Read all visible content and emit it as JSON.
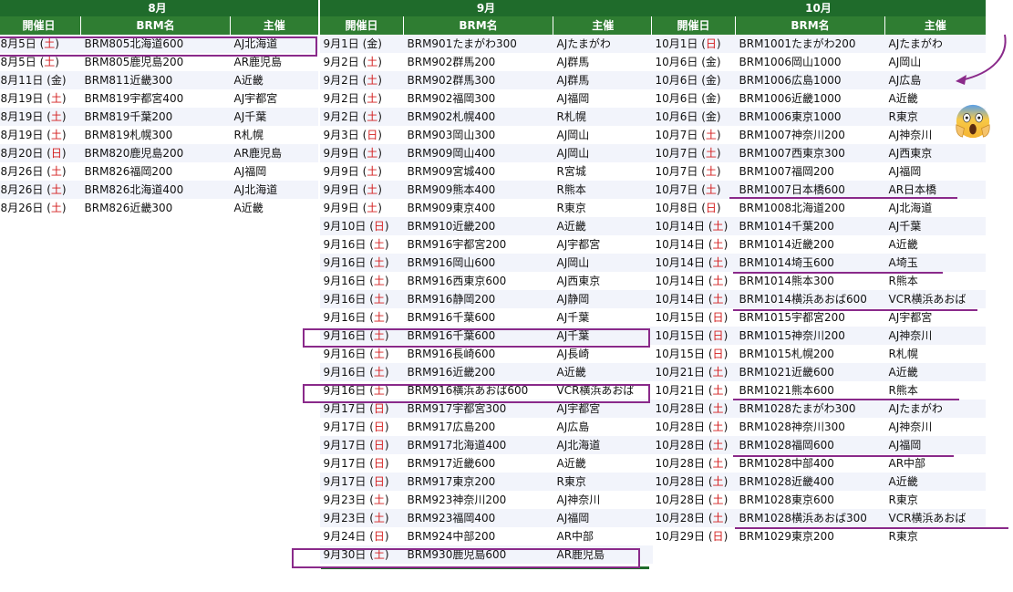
{
  "columns": [
    {
      "month": "8月",
      "headers": [
        "開催日",
        "BRM名",
        "主催"
      ],
      "rows": [
        {
          "date": "8月5日",
          "wd": "土",
          "name": "BRM805北海道600",
          "org": "AJ北海道"
        },
        {
          "date": "8月5日",
          "wd": "土",
          "name": "BRM805鹿児島200",
          "org": "AR鹿児島"
        },
        {
          "date": "8月11日",
          "wd": "金",
          "name": "BRM811近畿300",
          "org": "A近畿"
        },
        {
          "date": "8月19日",
          "wd": "土",
          "name": "BRM819宇都宮400",
          "org": "AJ宇都宮"
        },
        {
          "date": "8月19日",
          "wd": "土",
          "name": "BRM819千葉200",
          "org": "AJ千葉"
        },
        {
          "date": "8月19日",
          "wd": "土",
          "name": "BRM819札幌300",
          "org": "R札幌"
        },
        {
          "date": "8月20日",
          "wd": "日",
          "name": "BRM820鹿児島200",
          "org": "AR鹿児島"
        },
        {
          "date": "8月26日",
          "wd": "土",
          "name": "BRM826福岡200",
          "org": "AJ福岡"
        },
        {
          "date": "8月26日",
          "wd": "土",
          "name": "BRM826北海道400",
          "org": "AJ北海道"
        },
        {
          "date": "8月26日",
          "wd": "土",
          "name": "BRM826近畿300",
          "org": "A近畿"
        }
      ]
    },
    {
      "month": "9月",
      "headers": [
        "開催日",
        "BRM名",
        "主催"
      ],
      "rows": [
        {
          "date": "9月1日",
          "wd": "金",
          "name": "BRM901たまがわ300",
          "org": "AJたまがわ"
        },
        {
          "date": "9月2日",
          "wd": "土",
          "name": "BRM902群馬200",
          "org": "AJ群馬"
        },
        {
          "date": "9月2日",
          "wd": "土",
          "name": "BRM902群馬300",
          "org": "AJ群馬"
        },
        {
          "date": "9月2日",
          "wd": "土",
          "name": "BRM902福岡300",
          "org": "AJ福岡"
        },
        {
          "date": "9月2日",
          "wd": "土",
          "name": "BRM902札幌400",
          "org": "R札幌"
        },
        {
          "date": "9月3日",
          "wd": "日",
          "name": "BRM903岡山300",
          "org": "AJ岡山"
        },
        {
          "date": "9月9日",
          "wd": "土",
          "name": "BRM909岡山400",
          "org": "AJ岡山"
        },
        {
          "date": "9月9日",
          "wd": "土",
          "name": "BRM909宮城400",
          "org": "R宮城"
        },
        {
          "date": "9月9日",
          "wd": "土",
          "name": "BRM909熊本400",
          "org": "R熊本"
        },
        {
          "date": "9月9日",
          "wd": "土",
          "name": "BRM909東京400",
          "org": "R東京"
        },
        {
          "date": "9月10日",
          "wd": "日",
          "name": "BRM910近畿200",
          "org": "A近畿"
        },
        {
          "date": "9月16日",
          "wd": "土",
          "name": "BRM916宇都宮200",
          "org": "AJ宇都宮"
        },
        {
          "date": "9月16日",
          "wd": "土",
          "name": "BRM916岡山600",
          "org": "AJ岡山"
        },
        {
          "date": "9月16日",
          "wd": "土",
          "name": "BRM916西東京600",
          "org": "AJ西東京"
        },
        {
          "date": "9月16日",
          "wd": "土",
          "name": "BRM916静岡200",
          "org": "AJ静岡"
        },
        {
          "date": "9月16日",
          "wd": "土",
          "name": "BRM916千葉600",
          "org": "AJ千葉"
        },
        {
          "date": "9月16日",
          "wd": "土",
          "name": "BRM916千葉600",
          "org": "AJ千葉"
        },
        {
          "date": "9月16日",
          "wd": "土",
          "name": "BRM916長崎600",
          "org": "AJ長崎"
        },
        {
          "date": "9月16日",
          "wd": "土",
          "name": "BRM916近畿200",
          "org": "A近畿"
        },
        {
          "date": "9月16日",
          "wd": "土",
          "name": "BRM916横浜あおば600",
          "org": "VCR横浜あおば"
        },
        {
          "date": "9月17日",
          "wd": "日",
          "name": "BRM917宇都宮300",
          "org": "AJ宇都宮"
        },
        {
          "date": "9月17日",
          "wd": "日",
          "name": "BRM917広島200",
          "org": "AJ広島"
        },
        {
          "date": "9月17日",
          "wd": "日",
          "name": "BRM917北海道400",
          "org": "AJ北海道"
        },
        {
          "date": "9月17日",
          "wd": "日",
          "name": "BRM917近畿600",
          "org": "A近畿"
        },
        {
          "date": "9月17日",
          "wd": "日",
          "name": "BRM917東京200",
          "org": "R東京"
        },
        {
          "date": "9月23日",
          "wd": "土",
          "name": "BRM923神奈川200",
          "org": "AJ神奈川"
        },
        {
          "date": "9月23日",
          "wd": "土",
          "name": "BRM923福岡400",
          "org": "AJ福岡"
        },
        {
          "date": "9月24日",
          "wd": "日",
          "name": "BRM924中部200",
          "org": "AR中部"
        },
        {
          "date": "9月30日",
          "wd": "土",
          "name": "BRM930鹿児島600",
          "org": "AR鹿児島"
        }
      ]
    },
    {
      "month": "10月",
      "headers": [
        "開催日",
        "BRM名",
        "主催"
      ],
      "rows": [
        {
          "date": "10月1日",
          "wd": "日",
          "name": "BRM1001たまがわ200",
          "org": "AJたまがわ"
        },
        {
          "date": "10月6日",
          "wd": "金",
          "name": "BRM1006岡山1000",
          "org": "AJ岡山"
        },
        {
          "date": "10月6日",
          "wd": "金",
          "name": "BRM1006広島1000",
          "org": "AJ広島"
        },
        {
          "date": "10月6日",
          "wd": "金",
          "name": "BRM1006近畿1000",
          "org": "A近畿"
        },
        {
          "date": "10月6日",
          "wd": "金",
          "name": "BRM1006東京1000",
          "org": "R東京"
        },
        {
          "date": "10月7日",
          "wd": "土",
          "name": "BRM1007神奈川200",
          "org": "AJ神奈川"
        },
        {
          "date": "10月7日",
          "wd": "土",
          "name": "BRM1007西東京300",
          "org": "AJ西東京"
        },
        {
          "date": "10月7日",
          "wd": "土",
          "name": "BRM1007福岡200",
          "org": "AJ福岡"
        },
        {
          "date": "10月7日",
          "wd": "土",
          "name": "BRM1007日本橋600",
          "org": "AR日本橋"
        },
        {
          "date": "10月8日",
          "wd": "日",
          "name": "BRM1008北海道200",
          "org": "AJ北海道"
        },
        {
          "date": "10月14日",
          "wd": "土",
          "name": "BRM1014千葉200",
          "org": "AJ千葉"
        },
        {
          "date": "10月14日",
          "wd": "土",
          "name": "BRM1014近畿200",
          "org": "A近畿"
        },
        {
          "date": "10月14日",
          "wd": "土",
          "name": "BRM1014埼玉600",
          "org": "A埼玉"
        },
        {
          "date": "10月14日",
          "wd": "土",
          "name": "BRM1014熊本300",
          "org": "R熊本"
        },
        {
          "date": "10月14日",
          "wd": "土",
          "name": "BRM1014横浜あおば600",
          "org": "VCR横浜あおば"
        },
        {
          "date": "10月15日",
          "wd": "日",
          "name": "BRM1015宇都宮200",
          "org": "AJ宇都宮"
        },
        {
          "date": "10月15日",
          "wd": "日",
          "name": "BRM1015神奈川200",
          "org": "AJ神奈川"
        },
        {
          "date": "10月15日",
          "wd": "日",
          "name": "BRM1015札幌200",
          "org": "R札幌"
        },
        {
          "date": "10月21日",
          "wd": "土",
          "name": "BRM1021近畿600",
          "org": "A近畿"
        },
        {
          "date": "10月21日",
          "wd": "土",
          "name": "BRM1021熊本600",
          "org": "R熊本"
        },
        {
          "date": "10月28日",
          "wd": "土",
          "name": "BRM1028たまがわ300",
          "org": "AJたまがわ"
        },
        {
          "date": "10月28日",
          "wd": "土",
          "name": "BRM1028神奈川300",
          "org": "AJ神奈川"
        },
        {
          "date": "10月28日",
          "wd": "土",
          "name": "BRM1028福岡600",
          "org": "AJ福岡"
        },
        {
          "date": "10月28日",
          "wd": "土",
          "name": "BRM1028中部400",
          "org": "AR中部"
        },
        {
          "date": "10月28日",
          "wd": "土",
          "name": "BRM1028近畿400",
          "org": "A近畿"
        },
        {
          "date": "10月28日",
          "wd": "土",
          "name": "BRM1028東京600",
          "org": "R東京"
        },
        {
          "date": "10月28日",
          "wd": "土",
          "name": "BRM1028横浜あおば300",
          "org": "VCR横浜あおば"
        },
        {
          "date": "10月29日",
          "wd": "日",
          "name": "BRM1029東京200",
          "org": "R東京"
        }
      ]
    }
  ],
  "annotation": {
    "emoji": "scream",
    "color": "#8a2a8a"
  }
}
